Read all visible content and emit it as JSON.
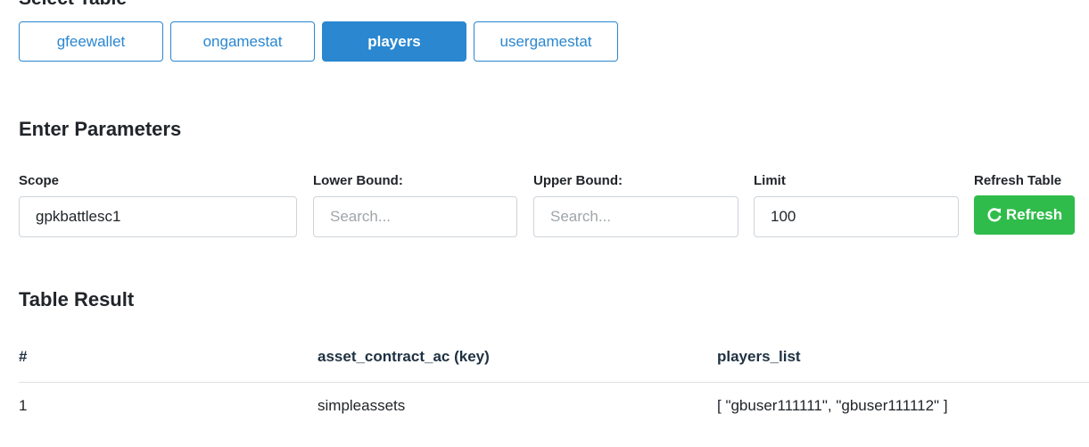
{
  "tabs": {
    "items": [
      {
        "label": "gfeewallet"
      },
      {
        "label": "ongamestat"
      },
      {
        "label": "players"
      },
      {
        "label": "usergamestat"
      }
    ]
  },
  "params": {
    "heading": "Enter Parameters",
    "scope": {
      "label": "Scope",
      "value": "gpkbattlesc1"
    },
    "lower_bound": {
      "label": "Lower Bound:",
      "placeholder": "Search..."
    },
    "upper_bound": {
      "label": "Upper Bound:",
      "placeholder": "Search..."
    },
    "limit": {
      "label": "Limit",
      "value": "100"
    },
    "refresh": {
      "label": "Refresh Table",
      "button_label": "Refresh",
      "icon": "refresh-icon"
    }
  },
  "result": {
    "heading": "Table Result",
    "columns": [
      "#",
      "asset_contract_ac (key)",
      "players_list"
    ],
    "rows": [
      [
        "1",
        "simpleassets",
        "[ \"gbuser111111\", \"gbuser111112\" ]"
      ]
    ]
  },
  "colors": {
    "primary": "#2a87d0",
    "success": "#2fbc4b",
    "header_text": "#1f3142"
  }
}
